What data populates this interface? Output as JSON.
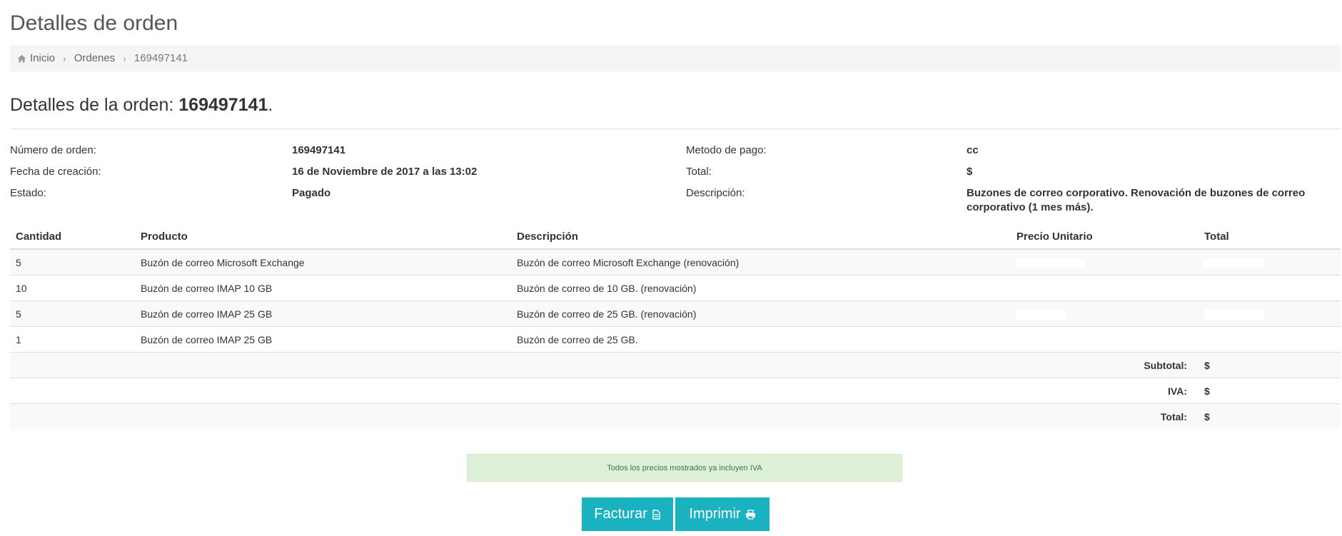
{
  "page": {
    "title": "Detalles de orden"
  },
  "breadcrumb": {
    "home": "Inicio",
    "orders": "Ordenes",
    "current": "169497141"
  },
  "order": {
    "heading_prefix": "Detalles de la orden: ",
    "heading_number": "169497141",
    "heading_suffix": ".",
    "labels": {
      "number": "Número de orden:",
      "created": "Fecha de creación:",
      "status": "Estado:",
      "payment": "Metodo de pago:",
      "total": "Total:",
      "description": "Descripción:"
    },
    "values": {
      "number": "169497141",
      "created": "16 de Noviembre de 2017 a las 13:02",
      "status": "Pagado",
      "payment": "cc",
      "total": "$",
      "description": "Buzones de correo corporativo. Renovación de buzones de correo corporativo (1 mes más)."
    }
  },
  "table": {
    "headers": [
      "Cantidad",
      "Producto",
      "Descripción",
      "Precio Unitario",
      "Total"
    ],
    "rows": [
      {
        "qty": "5",
        "product": "Buzón de correo Microsoft Exchange",
        "description": "Buzón de correo Microsoft Exchange (renovación)"
      },
      {
        "qty": "10",
        "product": "Buzón de correo IMAP 10 GB",
        "description": "Buzón de correo de 10 GB. (renovación)"
      },
      {
        "qty": "5",
        "product": "Buzón de correo IMAP 25 GB",
        "description": "Buzón de correo de 25 GB. (renovación)"
      },
      {
        "qty": "1",
        "product": "Buzón de correo IMAP 25 GB",
        "description": "Buzón de correo de 25 GB."
      }
    ],
    "summary": {
      "subtotal_label": "Subtotal:",
      "subtotal_value": "$",
      "iva_label": "IVA:",
      "iva_value": "$",
      "total_label": "Total:",
      "total_value": "$"
    }
  },
  "notice": "Todos los precios mostrados ya incluyen IVA",
  "buttons": {
    "invoice": "Facturar",
    "print": "Imprimir"
  },
  "colors": {
    "accent": "#1ab1c1",
    "notice_bg": "#dff0d8",
    "notice_text": "#3c763d"
  },
  "icons": {
    "home": "home-icon",
    "invoice": "file-icon",
    "print": "print-icon"
  }
}
